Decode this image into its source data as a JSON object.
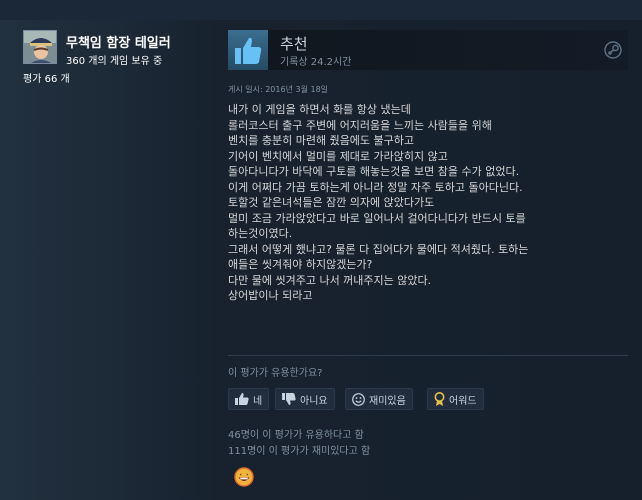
{
  "author": {
    "name": "무책임 함장 테일러",
    "games_owned": "360 개의 게임 보유 중",
    "review_count": "평가 66 개"
  },
  "review": {
    "recommendation": "추천",
    "playtime": "기록상 24.2시간",
    "posted": "게시 일시: 2016년 3월 18일",
    "lines": [
      "내가 이 게임을 하면서 화를 항상 냈는데",
      "롤러코스터 출구 주변에 어지러움을 느끼는 사람들을 위해",
      "벤치를 충분히 마련해 줬음에도 불구하고",
      "기어이 벤치에서 멀미를 제대로 가라앉히지 않고",
      "돌아다니다가 바닥에 구토를 해놓는것을 보면 참을 수가 없었다.",
      "이게 어쩌다 가끔 토하는게 아니라 정말 자주 토하고 돌아다닌다.",
      "토할것 같은녀석들은 잠깐 의자에 앉았다가도",
      "멀미 조금 가라앉았다고 바로 일어나서 걸어다니다가 반드시 토를",
      "하는것이였다.",
      "그래서 어떻게 했냐고? 물론 다 집어다가 물에다 적셔줬다. 토하는",
      "애들은 씻겨줘야 하지않겠는가?",
      "다만 물에 씻겨주고 나서 꺼내주지는 않았다.",
      "상어밥이나 되라고"
    ]
  },
  "feedback": {
    "question": "이 평가가 유용한가요?",
    "yes_label": "네",
    "no_label": "아니요",
    "funny_label": "재미있음",
    "award_label": "어워드",
    "helpful_stat": "46명이 이 평가가 유용하다고 함",
    "funny_stat": "111명이 이 평가가 재미있다고 함"
  },
  "icons": {
    "thumb": "thumbs-up-icon",
    "platform": "steam-icon",
    "award": "grinning-face-award-icon"
  },
  "colors": {
    "background": "#1b2838",
    "accent_blue": "#66c0f4",
    "text_muted": "#8091a2"
  }
}
